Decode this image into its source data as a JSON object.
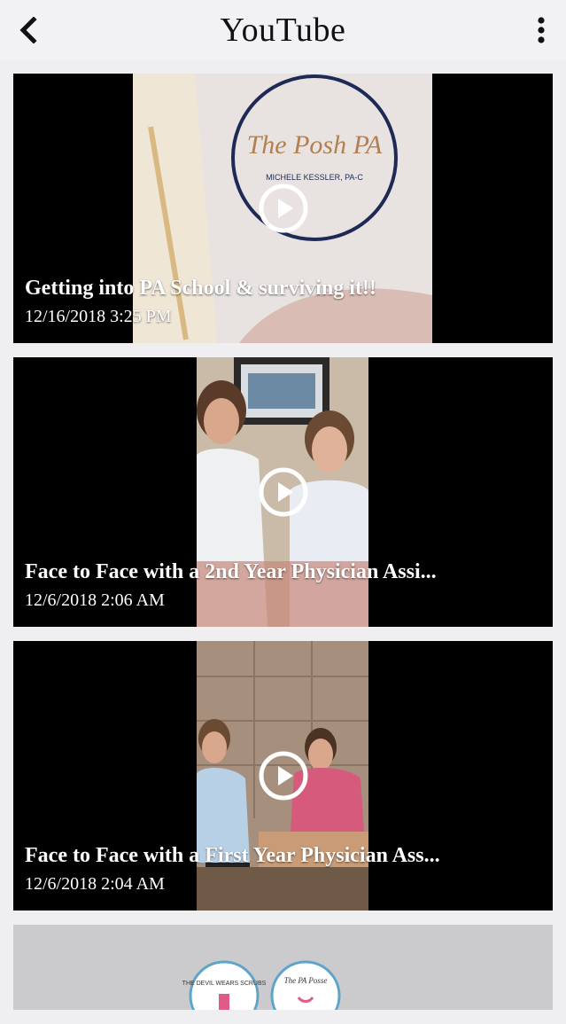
{
  "header": {
    "title": "YouTube",
    "back_icon": "chevron-left-icon",
    "menu_icon": "vertical-ellipsis-icon"
  },
  "videos": [
    {
      "title": "Getting into PA School & surviving it!!",
      "date": "12/16/2018 3:25 PM",
      "thumbnail_text_1": "The Posh PA",
      "thumbnail_text_2": "MICHELE KESSLER, PA-C"
    },
    {
      "title": "Face to Face with a 2nd Year Physician Assi...",
      "date": "12/6/2018 2:06 AM"
    },
    {
      "title": "Face to Face with a First Year Physician Ass...",
      "date": "12/6/2018 2:04 AM"
    },
    {
      "title": "",
      "date": "",
      "logo_text_1": "THE DEVIL WEARS SCRUBS",
      "logo_text_2": "The PA Posse"
    }
  ],
  "colors": {
    "header_bg": "#f2f1f4",
    "page_bg": "#efeef1",
    "card_bg": "#000000",
    "text_light": "#ffffff"
  }
}
